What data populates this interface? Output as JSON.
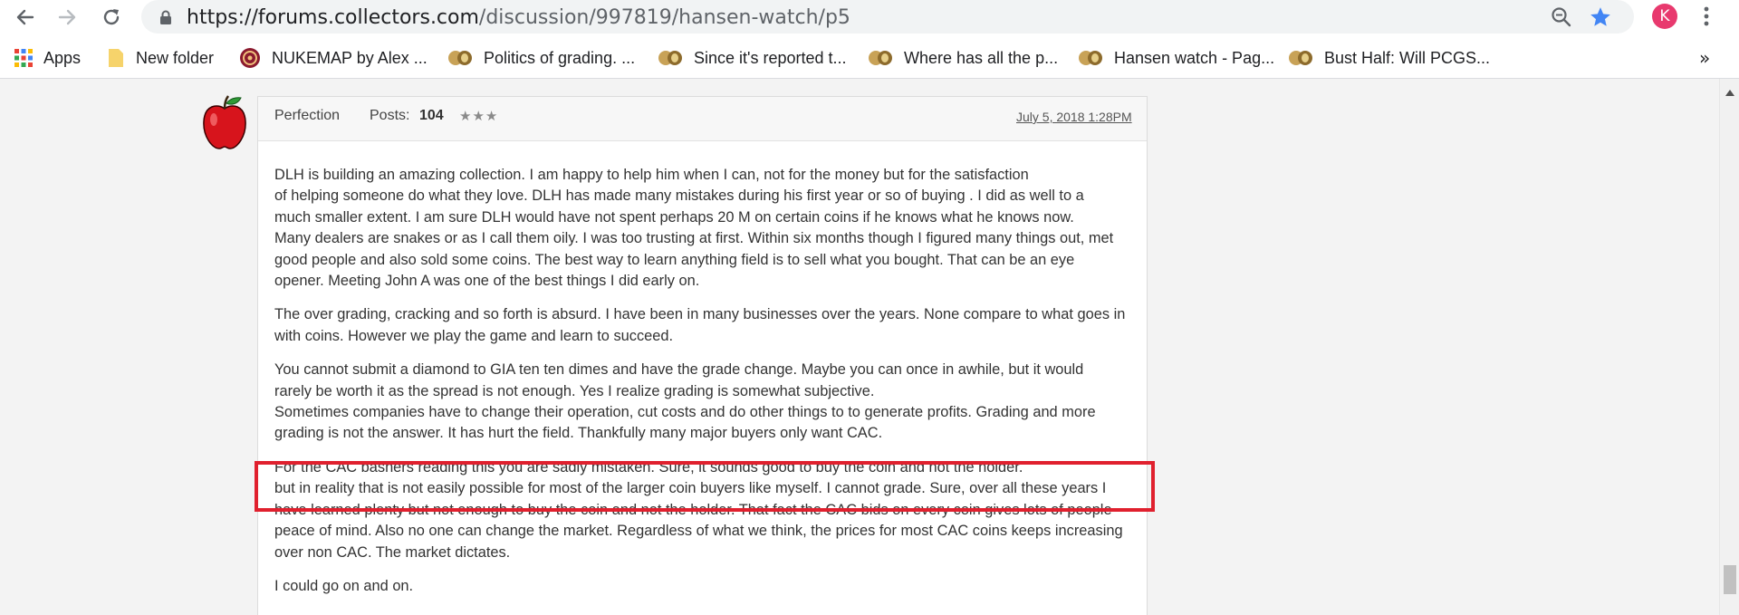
{
  "browser": {
    "url_host": "https://forums.collectors.com",
    "url_path": "/discussion/997819/hansen-watch/p5",
    "profile_initial": "K",
    "colors": {
      "profile": "#e8396e",
      "star": "#4285f4",
      "omnibox": "#f1f3f4"
    }
  },
  "bookmarks": [
    {
      "label": "Apps",
      "icon": "apps-grid-icon"
    },
    {
      "label": "New folder",
      "icon": "folder-icon"
    },
    {
      "label": "NUKEMAP by Alex ...",
      "icon": "nukemap-icon"
    },
    {
      "label": "Politics of grading. ...",
      "icon": "collectors-icon"
    },
    {
      "label": "Since it's reported t...",
      "icon": "collectors-icon"
    },
    {
      "label": "Where has all the p...",
      "icon": "collectors-icon"
    },
    {
      "label": "Hansen watch - Pag...",
      "icon": "collectors-icon"
    },
    {
      "label": "Bust Half: Will PCGS...",
      "icon": "collectors-icon"
    }
  ],
  "bookmarks_more": "»",
  "post": {
    "author": "Perfection",
    "posts_label": "Posts:",
    "posts_count": "104",
    "stars": "★★★",
    "date": "July 5, 2018 1:28PM",
    "paragraphs": [
      [
        "DLH is building an amazing collection. I am happy to help him when I can, not for the money but for the satisfaction",
        "of helping someone do what they love. DLH has made many mistakes during his first year or so of buying . I did as well to a",
        "much smaller extent. I am sure DLH would have not spent perhaps 20 M on certain coins if he knows what he knows now.",
        "Many dealers are snakes or as I call them oily. I was too trusting at first. Within six months though I figured many things out, met",
        "good people and also sold some coins. The best way to learn anything field is to sell what you bought. That can be an eye",
        "opener. Meeting John A was one of the best things I did early on."
      ],
      [
        "The over grading, cracking and so forth is absurd. I have been in many businesses over the years. None compare to what goes in",
        "with coins. However we play the game and learn to succeed."
      ],
      [
        "You cannot submit a diamond to GIA ten ten dimes and have the grade change. Maybe you can once in awhile, but it would",
        "rarely be worth it as the spread is not enough. Yes I realize grading is somewhat subjective.",
        "Sometimes companies have to change their operation, cut costs and do other things to to generate profits. Grading and more",
        "grading is not the answer. It has hurt the field. Thankfully many major buyers only want CAC."
      ],
      [
        "For the CAC bashers reading this you are sadly mistaken. Sure, it sounds good to buy the coin and not the holder.",
        "but in reality that is not easily possible for most of the larger coin buyers like myself. I cannot grade. Sure, over all these years I",
        "have learned plenty but not enough to buy the coin and not the holder. That fact the CAC bids on every coin gives lots of people",
        "peace of mind. Also no one can change the market. Regardless of what we think, the prices for most CAC coins keeps increasing",
        "over non CAC. The market dictates."
      ],
      [
        "I could go on and on."
      ]
    ]
  },
  "highlight_color": "#e0202e"
}
